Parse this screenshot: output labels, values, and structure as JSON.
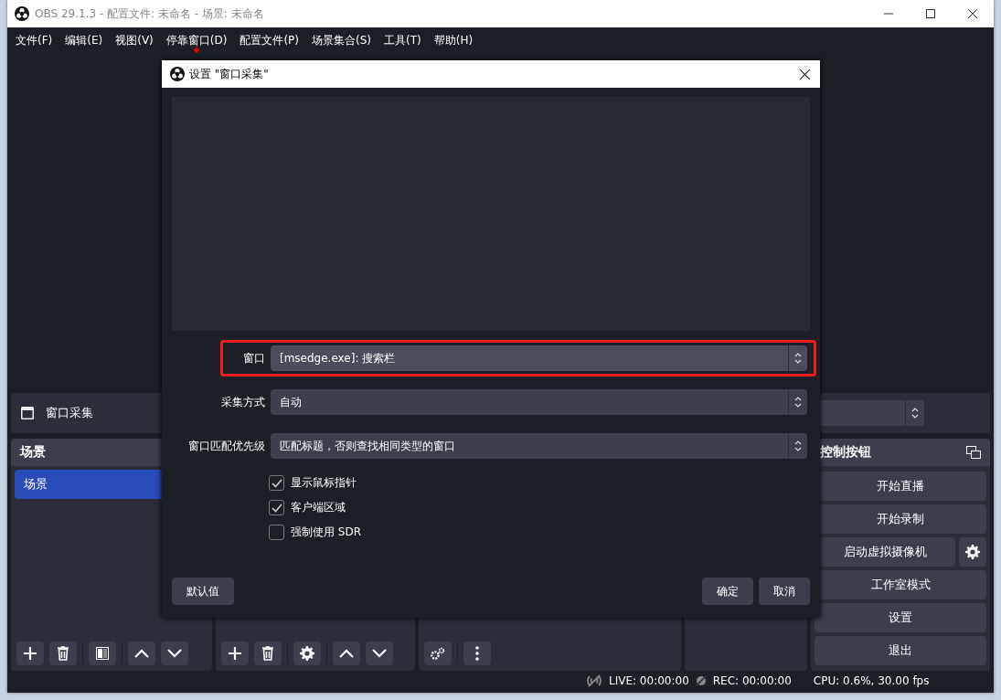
{
  "window": {
    "title": "OBS 29.1.3 - 配置文件: 未命名 - 场景: 未命名"
  },
  "menu": [
    {
      "label": "文件(F)",
      "marked": false
    },
    {
      "label": "编辑(E)",
      "marked": false
    },
    {
      "label": "视图(V)",
      "marked": false
    },
    {
      "label": "停靠窗口(D)",
      "marked": true
    },
    {
      "label": "配置文件(P)",
      "marked": false
    },
    {
      "label": "场景集合(S)",
      "marked": false
    },
    {
      "label": "工具(T)",
      "marked": false
    },
    {
      "label": "帮助(H)",
      "marked": false
    }
  ],
  "source_toolbar": {
    "source_name": "窗口采集"
  },
  "scenes": {
    "title": "场景",
    "items": [
      {
        "label": "场景",
        "selected": true
      }
    ]
  },
  "controls": {
    "title": "控制按钮",
    "buttons": [
      {
        "label": "开始直播",
        "kind": "plain"
      },
      {
        "label": "开始录制",
        "kind": "plain"
      },
      {
        "label": "启动虚拟摄像机",
        "kind": "with_settings"
      },
      {
        "label": "工作室模式",
        "kind": "plain"
      },
      {
        "label": "设置",
        "kind": "plain"
      },
      {
        "label": "退出",
        "kind": "plain"
      }
    ]
  },
  "status_bar": {
    "live": "LIVE: 00:00:00",
    "rec": "REC: 00:00:00",
    "cpu": "CPU: 0.6%, 30.00 fps"
  },
  "dialog": {
    "title": "设置 \"窗口采集\"",
    "fields": [
      {
        "label": "窗口",
        "value": "[msedge.exe]: 搜索栏",
        "highlighted": true
      },
      {
        "label": "采集方式",
        "value": "自动",
        "highlighted": false
      },
      {
        "label": "窗口匹配优先级",
        "value": "匹配标题，否则查找相同类型的窗口",
        "highlighted": false
      }
    ],
    "checkboxes": [
      {
        "label": "显示鼠标指针",
        "checked": true
      },
      {
        "label": "客户端区域",
        "checked": true
      },
      {
        "label": "强制使用 SDR",
        "checked": false
      }
    ],
    "defaults_button": "默认值",
    "ok_button": "确定",
    "cancel_button": "取消"
  }
}
